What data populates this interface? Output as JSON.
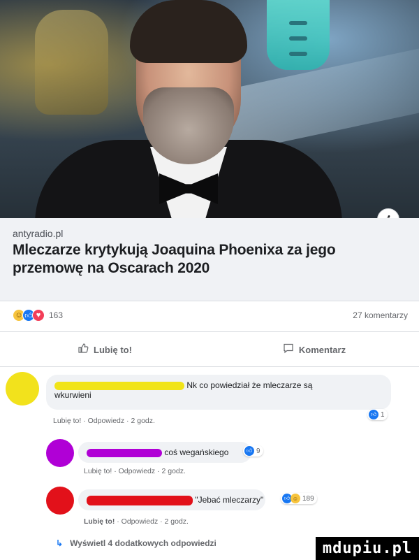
{
  "preview": {
    "domain": "antyradio.pl",
    "headline": "Mleczarze krytykują Joaquina Phoenixa za jego przemowę na Oscarach 2020"
  },
  "reactions": {
    "icons": [
      "haha-icon",
      "like-icon",
      "love-icon"
    ],
    "count": "163",
    "comments": "27 komentarzy"
  },
  "actions": {
    "like_label": "Lubię to!",
    "comment_label": "Komentarz"
  },
  "comments": [
    {
      "text": "Nk co powiedział że mleczarze są",
      "text2": "wkurwieni",
      "meta": "Lubię to! · Odpowiedz · 2 godz.",
      "reaction_count": "1",
      "redact_color": "#f1e41a"
    },
    {
      "text": "coś wegańskiego",
      "meta": "Lubię to! · Odpowiedz · 2 godz.",
      "reaction_count": "9",
      "redact_color": "#b000d6"
    },
    {
      "text": "\"Jebać mleczarzy\"",
      "meta_like": "Lubię to!",
      "meta_rest": " · Odpowiedz · 2 godz.",
      "reaction_count": "189",
      "redact_color": "#e2111a"
    }
  ],
  "more_replies": "Wyświetl 4 dodatkowych odpowiedzi",
  "watermark": "mdupiu.pl",
  "colors": {
    "facebook_blue": "#1877f2",
    "bubble_gray": "#f0f2f5"
  }
}
